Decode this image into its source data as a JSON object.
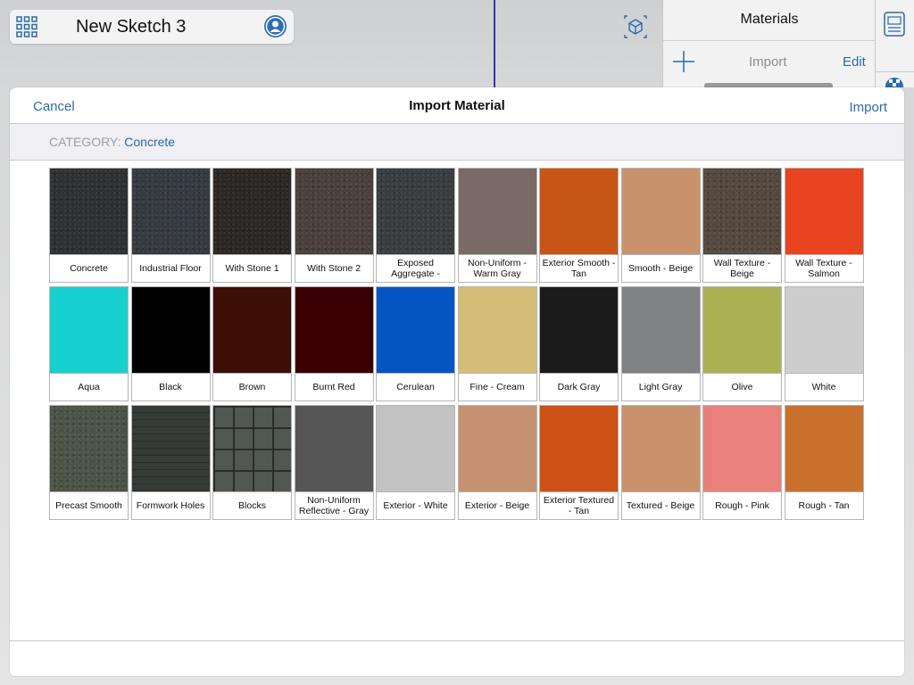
{
  "app": {
    "sketch_title": "New Sketch 3",
    "materials_panel": {
      "title": "Materials",
      "import_label": "Import",
      "edit_label": "Edit"
    }
  },
  "modal": {
    "title": "Import Material",
    "cancel_label": "Cancel",
    "import_label": "Import",
    "category_label": "CATEGORY:",
    "category_value": "Concrete"
  },
  "materials": [
    {
      "name": "Concrete",
      "color": "#2f3032",
      "texture": "noise"
    },
    {
      "name": "Industrial Floor",
      "color": "#353a40",
      "texture": "noise"
    },
    {
      "name": "With Stone 1",
      "color": "#2b2724",
      "texture": "noise"
    },
    {
      "name": "With Stone 2",
      "color": "#4a403b",
      "texture": "noise"
    },
    {
      "name": "Exposed Aggregate -",
      "color": "#3a3d3f",
      "texture": "noise"
    },
    {
      "name": "Non-Uniform - Warm Gray",
      "color": "#7a6a66",
      "texture": "none"
    },
    {
      "name": "Exterior Smooth - Tan",
      "color": "#c75516",
      "texture": "none"
    },
    {
      "name": "Smooth - Beige",
      "color": "#c8936c",
      "texture": "none"
    },
    {
      "name": "Wall Texture - Beige",
      "color": "#55483f",
      "texture": "noise"
    },
    {
      "name": "Wall Texture - Salmon",
      "color": "#e8441f",
      "texture": "none"
    },
    {
      "name": "Aqua",
      "color": "#17d0d0",
      "texture": "none"
    },
    {
      "name": "Black",
      "color": "#020202",
      "texture": "none"
    },
    {
      "name": "Brown",
      "color": "#3d0e06",
      "texture": "none"
    },
    {
      "name": "Burnt Red",
      "color": "#3a0004",
      "texture": "none"
    },
    {
      "name": "Cerulean",
      "color": "#0455c2",
      "texture": "none"
    },
    {
      "name": "Fine - Cream",
      "color": "#d4bd76",
      "texture": "none"
    },
    {
      "name": "Dark Gray",
      "color": "#1b1b1c",
      "texture": "none"
    },
    {
      "name": "Light Gray",
      "color": "#808182",
      "texture": "none"
    },
    {
      "name": "Olive",
      "color": "#a9b152",
      "texture": "none"
    },
    {
      "name": "White",
      "color": "#cdcdcd",
      "texture": "none"
    },
    {
      "name": "Precast Smooth",
      "color": "#4b5446",
      "texture": "noise"
    },
    {
      "name": "Formwork Holes",
      "color": "#363b38",
      "texture": "lines"
    },
    {
      "name": "Blocks",
      "color": "#515854",
      "texture": "grid"
    },
    {
      "name": "Non-Uniform Reflective - Gray",
      "color": "#555556",
      "texture": "none"
    },
    {
      "name": "Exterior - White",
      "color": "#c2c2c3",
      "texture": "none"
    },
    {
      "name": "Exterior - Beige",
      "color": "#c69170",
      "texture": "none"
    },
    {
      "name": "Exterior Textured - Tan",
      "color": "#cd5015",
      "texture": "none"
    },
    {
      "name": "Textured - Beige",
      "color": "#c9926c",
      "texture": "none"
    },
    {
      "name": "Rough - Pink",
      "color": "#e9807c",
      "texture": "none"
    },
    {
      "name": "Rough - Tan",
      "color": "#c9702d",
      "texture": "none"
    }
  ]
}
